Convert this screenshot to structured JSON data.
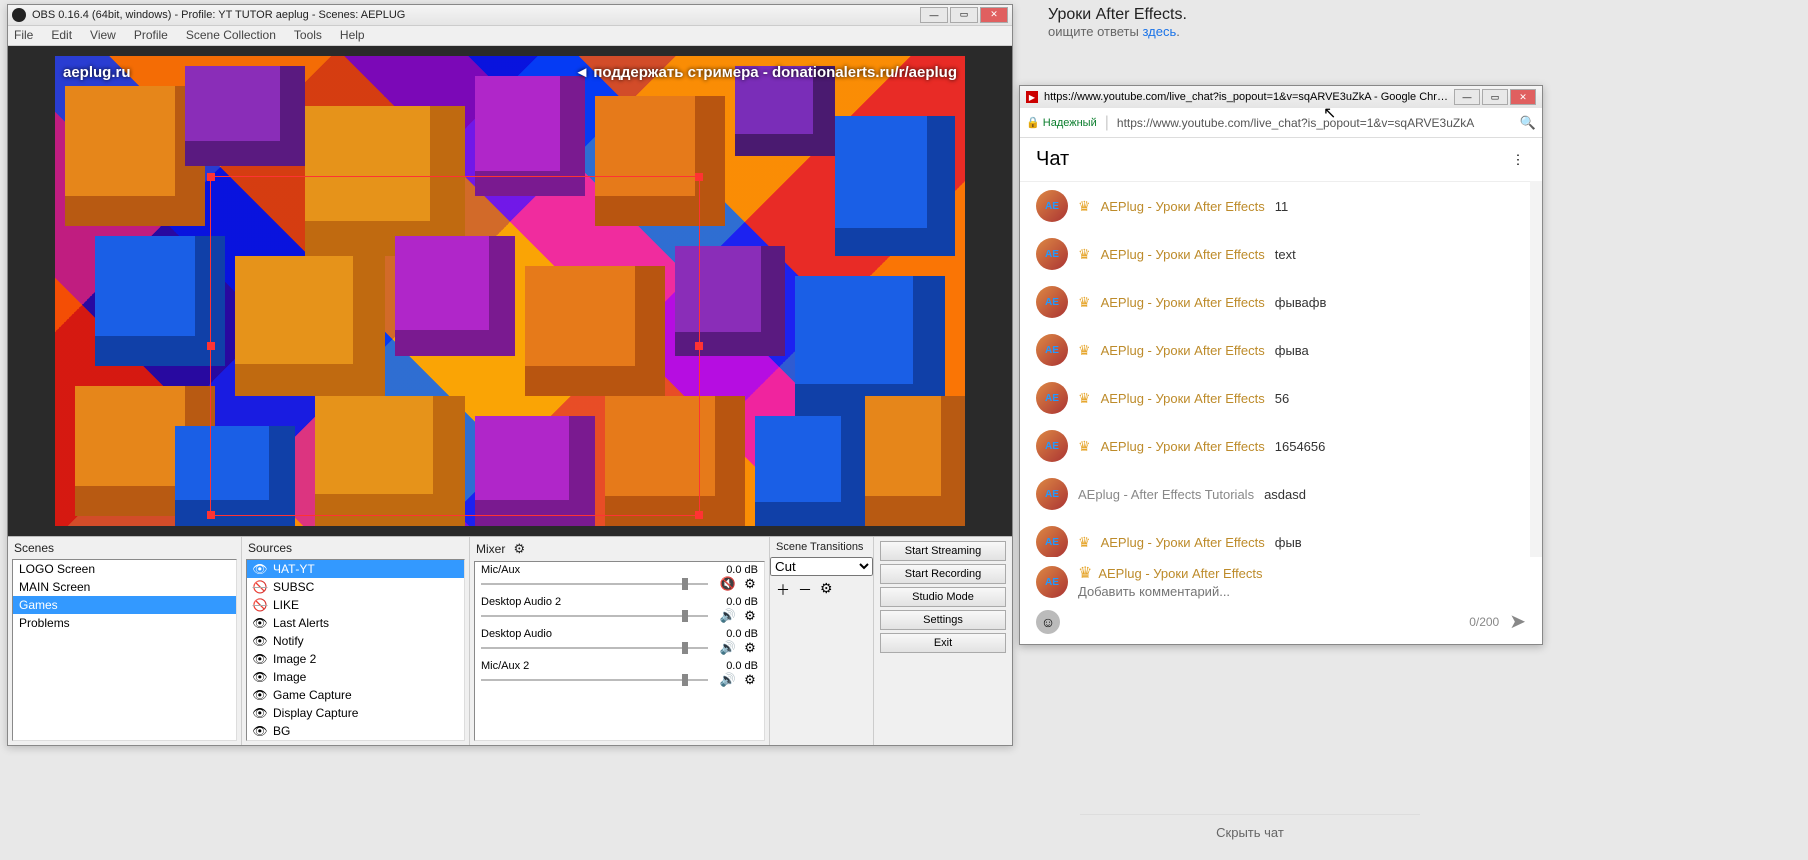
{
  "background": {
    "title": "Уроки After Effects.",
    "subtitle_prefix": "оищите ответы ",
    "subtitle_link": "здесь",
    "subtitle_suffix": ".",
    "hide_chat": "Скрыть чат"
  },
  "obs": {
    "title": "OBS 0.16.4 (64bit, windows) - Profile: YT TUTOR aeplug - Scenes: AEPLUG",
    "menu": [
      "File",
      "Edit",
      "View",
      "Profile",
      "Scene Collection",
      "Tools",
      "Help"
    ],
    "overlay_left": "aeplug.ru",
    "overlay_right": "поддержать стримера - donationalerts.ru/r/aeplug",
    "scenes": {
      "title": "Scenes",
      "items": [
        "LOGO Screen",
        "MAIN Screen",
        "Games",
        "Problems"
      ],
      "selected": 2
    },
    "sources": {
      "title": "Sources",
      "items": [
        {
          "label": "ЧАТ-YT",
          "visible": true,
          "selected": true
        },
        {
          "label": "SUBSC",
          "visible": false
        },
        {
          "label": "LIKE",
          "visible": false
        },
        {
          "label": "Last Alerts",
          "visible": true
        },
        {
          "label": "Notify",
          "visible": true
        },
        {
          "label": "Image 2",
          "visible": true
        },
        {
          "label": "Image",
          "visible": true
        },
        {
          "label": "Game Capture",
          "visible": true
        },
        {
          "label": "Display Capture",
          "visible": true
        },
        {
          "label": "BG",
          "visible": true
        }
      ]
    },
    "mixer": {
      "title": "Mixer",
      "tracks": [
        {
          "name": "Mic/Aux",
          "db": "0.0 dB",
          "muted": true
        },
        {
          "name": "Desktop Audio 2",
          "db": "0.0 dB",
          "muted": false
        },
        {
          "name": "Desktop Audio",
          "db": "0.0 dB",
          "muted": false
        },
        {
          "name": "Mic/Aux 2",
          "db": "0.0 dB",
          "muted": false
        }
      ]
    },
    "transitions": {
      "title": "Scene Transitions",
      "selected": "Cut"
    },
    "controls": {
      "start_streaming": "Start Streaming",
      "start_recording": "Start Recording",
      "studio_mode": "Studio Mode",
      "settings": "Settings",
      "exit": "Exit"
    }
  },
  "chrome": {
    "title": "https://www.youtube.com/live_chat?is_popout=1&v=sqARVE3uZkA - Google Chrome",
    "secure_label": "Надежный",
    "url": "https://www.youtube.com/live_chat?is_popout=1&v=sqARVE3uZkA",
    "chat_title": "Чат",
    "messages": [
      {
        "author": "AEPlug - Уроки After Effects",
        "text": "11",
        "badge": true
      },
      {
        "author": "AEPlug - Уроки After Effects",
        "text": "text",
        "badge": true
      },
      {
        "author": "AEPlug - Уроки After Effects",
        "text": "фывафв",
        "badge": true
      },
      {
        "author": "AEPlug - Уроки After Effects",
        "text": "фыва",
        "badge": true
      },
      {
        "author": "AEPlug - Уроки After Effects",
        "text": "56",
        "badge": true
      },
      {
        "author": "AEPlug - Уроки After Effects",
        "text": "1654656",
        "badge": true
      },
      {
        "author": "AEplug - After Effects Tutorials",
        "text": "asdasd",
        "badge": false
      },
      {
        "author": "AEPlug - Уроки After Effects",
        "text": "фыв",
        "badge": true
      }
    ],
    "compose_author": "AEPlug - Уроки After Effects",
    "compose_placeholder": "Добавить комментарий...",
    "counter": "0/200"
  }
}
